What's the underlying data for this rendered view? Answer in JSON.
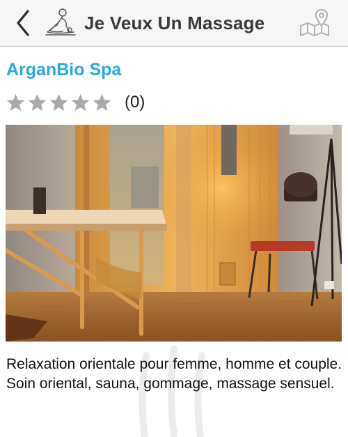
{
  "header": {
    "title": "Je Veux Un Massage",
    "back_icon": "chevron-left-icon",
    "logo_icon": "massage-logo-icon",
    "map_icon": "map-pin-icon"
  },
  "spa": {
    "name": "ArganBio Spa",
    "rating": 0,
    "max_rating": 5,
    "review_count": "(0)"
  },
  "photo": {
    "icon": "spa-room-photo"
  },
  "description": {
    "line1": "Relaxation orientale pour femme, homme et couple.",
    "line2": "Soin oriental, sauna, gommage, massage sensuel."
  },
  "colors": {
    "accent": "#2ba8e0",
    "star_empty": "#a9a9ad",
    "navbar_bg": "#f6f6f7",
    "title_text": "#3a3a3a"
  }
}
